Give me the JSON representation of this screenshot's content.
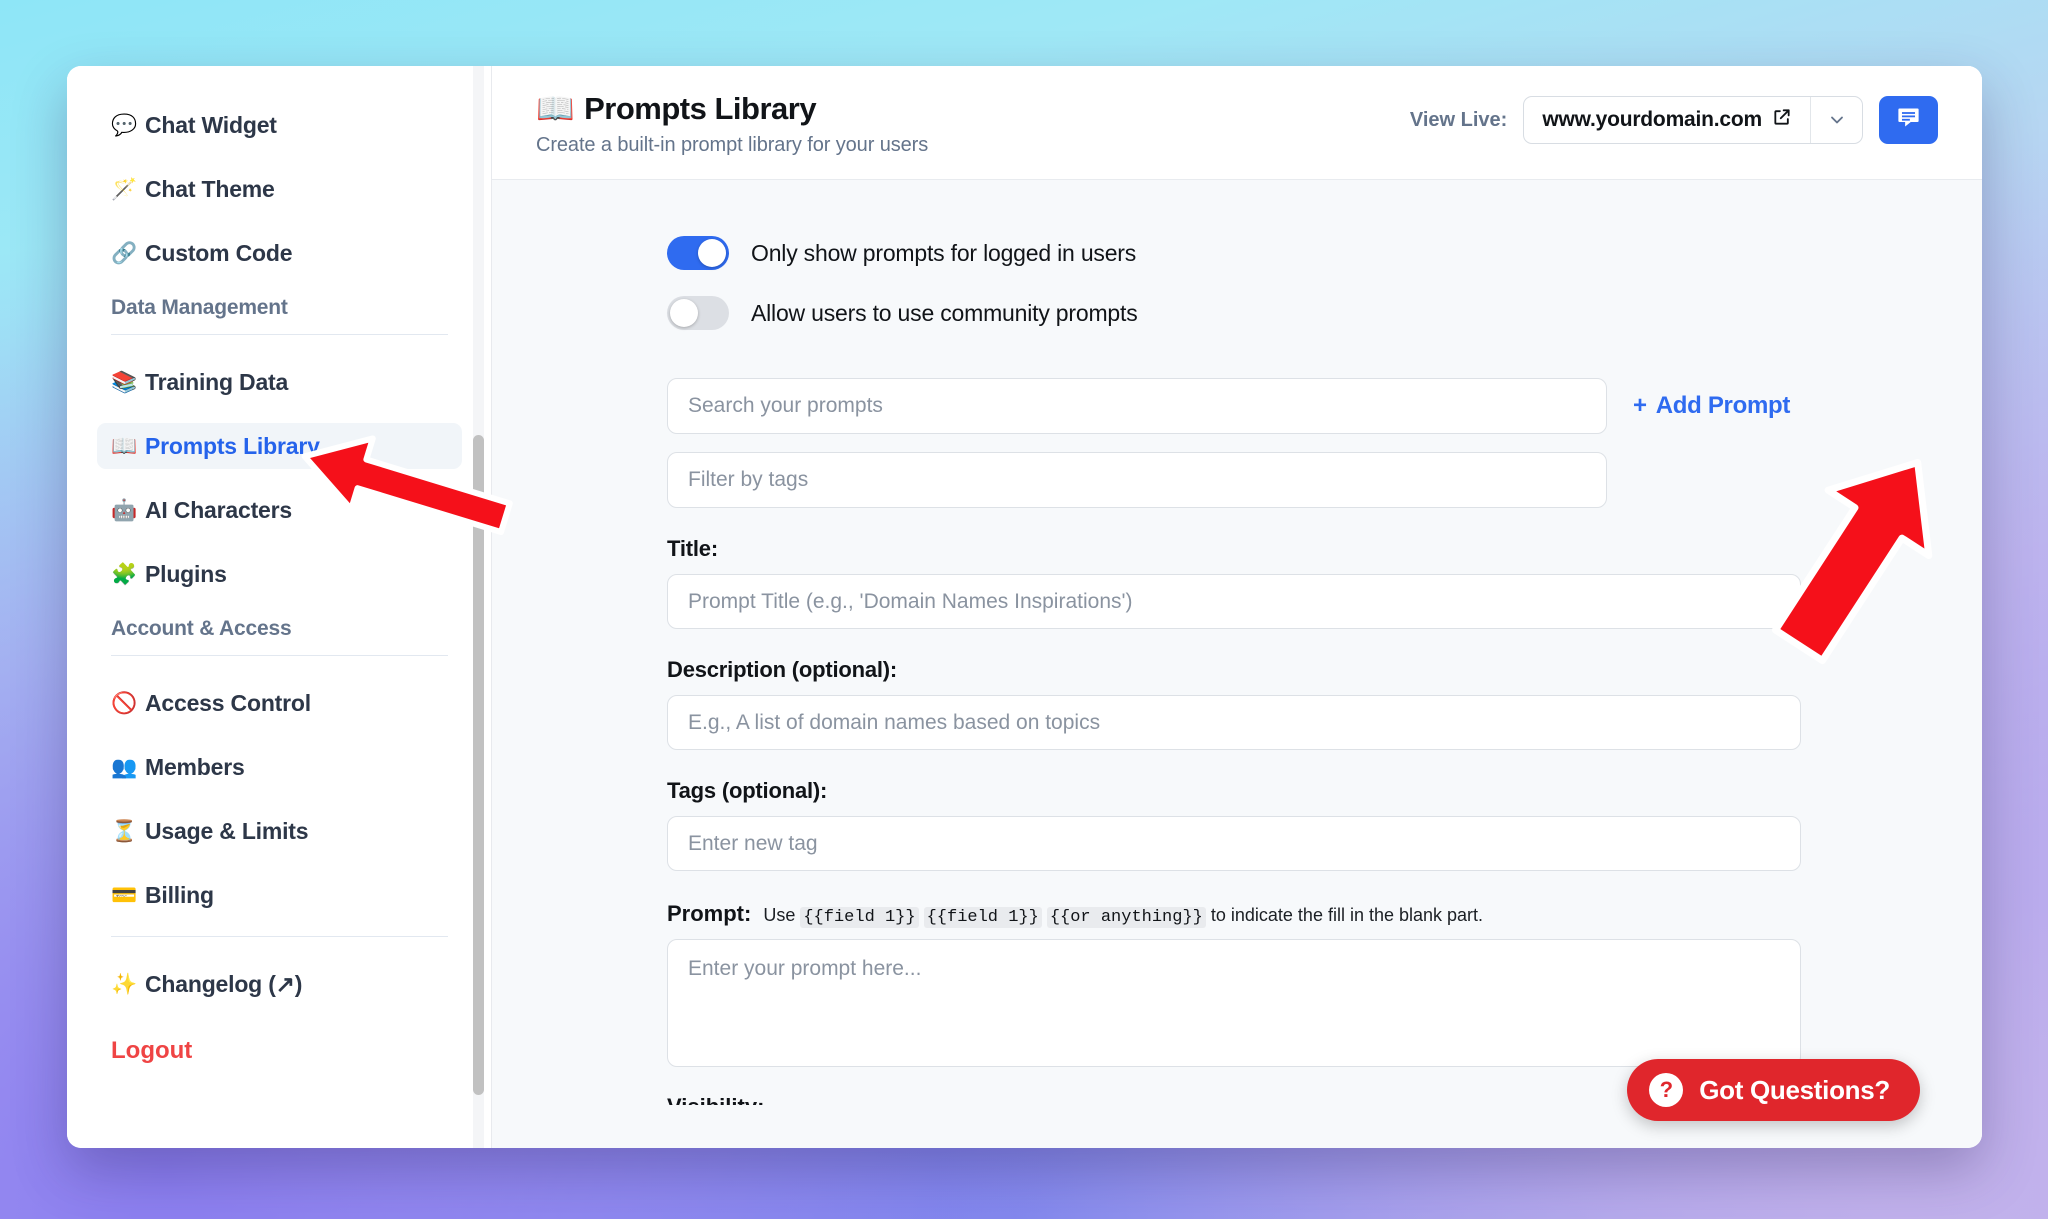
{
  "sidebar": {
    "items_top": [
      {
        "label": "Chat Widget",
        "icon": "💬",
        "icon_name": "speech-balloon-icon"
      },
      {
        "label": "Chat Theme",
        "icon": "🪄",
        "icon_name": "magic-wand-icon"
      },
      {
        "label": "Custom Code",
        "icon": "🔗",
        "icon_name": "link-icon"
      }
    ],
    "section_data": {
      "title": "Data Management",
      "items": [
        {
          "label": "Training Data",
          "icon": "📚",
          "icon_name": "books-icon",
          "active": false
        },
        {
          "label": "Prompts Library",
          "icon": "📖",
          "icon_name": "open-book-icon",
          "active": true
        },
        {
          "label": "AI Characters",
          "icon": "🤖",
          "icon_name": "robot-icon",
          "active": false
        },
        {
          "label": "Plugins",
          "icon": "🧩",
          "icon_name": "puzzle-piece-icon",
          "active": false
        }
      ]
    },
    "section_account": {
      "title": "Account & Access",
      "items": [
        {
          "label": "Access Control",
          "icon": "🚫",
          "icon_name": "prohibited-icon"
        },
        {
          "label": "Members",
          "icon": "👥",
          "icon_name": "people-icon"
        },
        {
          "label": "Usage & Limits",
          "icon": "⏳",
          "icon_name": "hourglass-icon"
        },
        {
          "label": "Billing",
          "icon": "💳",
          "icon_name": "credit-card-icon"
        }
      ]
    },
    "changelog": {
      "label": "Changelog (↗)",
      "icon": "✨",
      "icon_name": "sparkles-icon"
    },
    "logout_label": "Logout"
  },
  "header": {
    "title_icon": "📖",
    "title": "Prompts Library",
    "subtitle": "Create a built-in prompt library for your users",
    "view_live_label": "View Live:",
    "domain": "www.yourdomain.com"
  },
  "toggles": [
    {
      "label": "Only show prompts for logged in users",
      "on": true
    },
    {
      "label": "Allow users to use community prompts",
      "on": false
    }
  ],
  "search": {
    "search_placeholder": "Search your prompts",
    "search_value": "",
    "tags_placeholder": "Filter by tags",
    "tags_value": "",
    "add_prompt_label": "Add Prompt",
    "add_prompt_plus": "+"
  },
  "form": {
    "title_label": "Title:",
    "title_placeholder": "Prompt Title (e.g., 'Domain Names Inspirations')",
    "title_value": "",
    "description_label": "Description (optional):",
    "description_placeholder": "E.g., A list of domain names based on topics",
    "description_value": "",
    "tags_label": "Tags (optional):",
    "tags_placeholder": "Enter new tag",
    "tags_value": "",
    "prompt_label": "Prompt:",
    "prompt_hint_pre": "Use",
    "prompt_hint_token1": "{{field 1}}",
    "prompt_hint_token2": "{{field 1}}",
    "prompt_hint_token3": "{{or anything}}",
    "prompt_hint_post": "to indicate the fill in the blank part.",
    "prompt_placeholder": "Enter your prompt here...",
    "prompt_value": "",
    "visibility_label": "Visibility:"
  },
  "support": {
    "label": "Got Questions?",
    "mark": "?"
  },
  "colors": {
    "accent_blue": "#2f6bf0",
    "logout_red": "#ef4444",
    "support_red": "#e0262c",
    "annotation_red": "#f5101a",
    "active_bg": "#f1f5f9",
    "panel_bg": "#f7f9fb"
  }
}
